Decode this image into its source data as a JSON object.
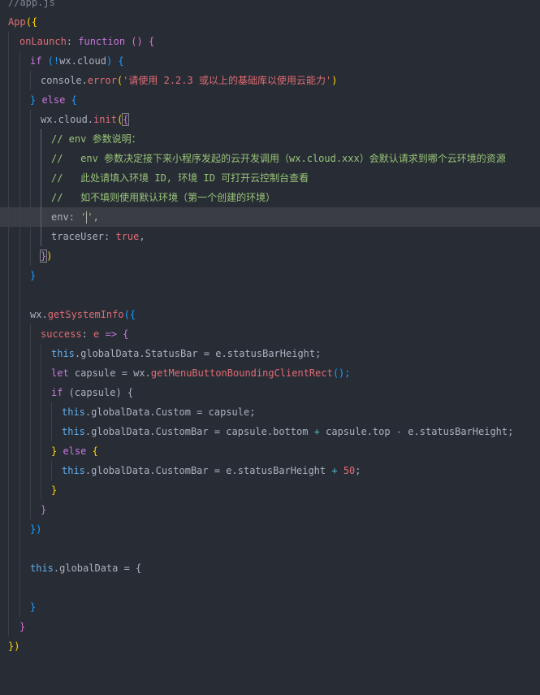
{
  "editor": {
    "lines": [
      [
        "//app.js"
      ],
      [
        "App",
        "({"
      ],
      [
        "onLaunch",
        ": ",
        "function",
        " () {"
      ],
      [
        "if",
        " (!",
        "wx.cloud",
        ") {"
      ],
      [
        "console.",
        "error",
        "(",
        "'请使用 2.2.3 或以上的基础库以使用云能力'",
        ")"
      ],
      [
        "}",
        " else ",
        "{"
      ],
      [
        "wx.cloud.",
        "init",
        "(",
        "{"
      ],
      [
        "// env 参数说明："
      ],
      [
        "//   env 参数决定接下来小程序发起的云开发调用（wx.cloud.xxx）会默认请求到哪个云环境的资源"
      ],
      [
        "//   此处请填入环境 ID, 环境 ID 可打开云控制台查看"
      ],
      [
        "//   如不填则使用默认环境（第一个创建的环境）"
      ],
      [
        "env",
        ": ",
        "''",
        ","
      ],
      [
        "traceUser",
        ": ",
        "true",
        ","
      ],
      [
        "}",
        ")"
      ],
      [
        "}"
      ],
      [
        ""
      ],
      [
        "wx.",
        "getSystemInfo",
        "({"
      ],
      [
        "success",
        ": ",
        "e",
        " => {"
      ],
      [
        "this",
        ".globalData.StatusBar = ",
        "e",
        ".statusBarHeight;"
      ],
      [
        "let",
        " capsule = ",
        "wx.",
        "getMenuButtonBoundingClientRect",
        "();"
      ],
      [
        "if",
        " (capsule) {"
      ],
      [
        "this",
        ".globalData.Custom = capsule;"
      ],
      [
        "this",
        ".globalData.CustomBar = capsule.bottom ",
        "+",
        " capsule.top ",
        "-",
        " ",
        "e",
        ".statusBarHeight;"
      ],
      [
        "}",
        " else ",
        "{"
      ],
      [
        "this",
        ".globalData.CustomBar = ",
        "e",
        ".statusBarHeight ",
        "+",
        " ",
        "50",
        ";"
      ],
      [
        "}"
      ],
      [
        "}"
      ],
      [
        "})"
      ],
      [
        ""
      ],
      [
        "this",
        ".globalData = {"
      ],
      [
        ""
      ],
      [
        "}"
      ],
      [
        "}"
      ],
      [
        "})"
      ]
    ]
  },
  "colors": {
    "background": "#282c34",
    "current_line": "#3a3d44",
    "keyword": "#c678dd",
    "string": "#98c379",
    "function": "#61afef"
  }
}
